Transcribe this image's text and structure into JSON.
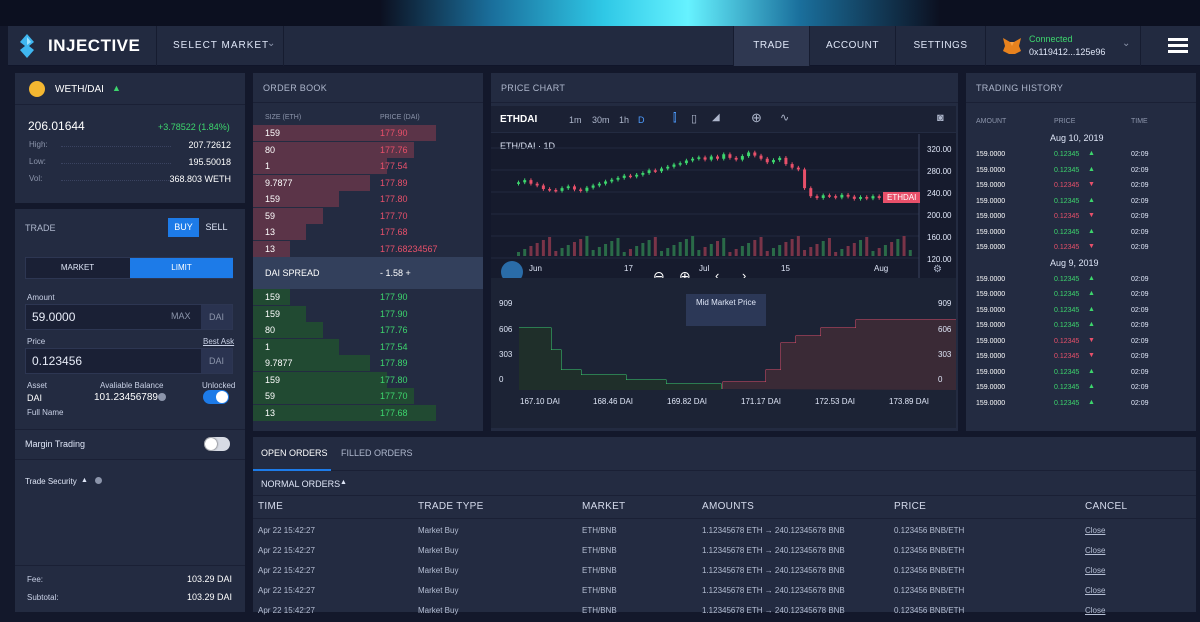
{
  "nav": {
    "brand": "INJECTIVE",
    "select_market": "SELECT MARKET",
    "tabs": [
      "TRADE",
      "ACCOUNT",
      "SETTINGS"
    ],
    "wallet_status": "Connected",
    "wallet_address": "0x119412...125e96"
  },
  "market": {
    "pair": "WETH/DAI",
    "price": "206.01644",
    "change": "+3.78522 (1.84%)",
    "stats": [
      {
        "label": "High:",
        "value": "207.72612"
      },
      {
        "label": "Low:",
        "value": "195.50018"
      },
      {
        "label": "Vol:",
        "value": "368.803 WETH"
      }
    ]
  },
  "trade": {
    "title": "TRADE",
    "buy": "BUY",
    "sell": "SELL",
    "market_tab": "MARKET",
    "limit_tab": "LIMIT",
    "amount_label": "Amount",
    "amount_value": "59.0000",
    "max": "MAX",
    "amount_unit": "DAI",
    "price_label": "Price",
    "best_ask": "Best Ask",
    "price_value": "0.123456",
    "price_unit": "DAI",
    "asset_label": "Asset",
    "asset_value": "DAI",
    "balance_label": "Avaliable Balance",
    "balance_value": "101.23456789",
    "unlocked_label": "Unlocked",
    "full_name": "Full Name",
    "margin": "Margin Trading",
    "security": "Trade Security",
    "fee_label": "Fee:",
    "fee_value": "103.29 DAI",
    "subtotal_label": "Subtotal:",
    "subtotal_value": "103.29 DAI"
  },
  "orderbook": {
    "title": "ORDER BOOK",
    "col_size": "SIZE (ETH)",
    "col_price": "PRICE (DAI)",
    "asks": [
      {
        "size": "159",
        "price": "177.90",
        "depth": 1.0
      },
      {
        "size": "80",
        "price": "177.76",
        "depth": 0.88
      },
      {
        "size": "1",
        "price": "177.54",
        "depth": 0.73
      },
      {
        "size": "9.7877",
        "price": "177.89",
        "depth": 0.64
      },
      {
        "size": "159",
        "price": "177.80",
        "depth": 0.47
      },
      {
        "size": "59",
        "price": "177.70",
        "depth": 0.38
      },
      {
        "size": "13",
        "price": "177.68",
        "depth": 0.29
      },
      {
        "size": "13",
        "price": "177.68234567",
        "depth": 0.2
      }
    ],
    "spread_label": "DAI SPREAD",
    "spread_value": "- 1.58 +",
    "bids": [
      {
        "size": "159",
        "price": "177.90",
        "depth": 0.2
      },
      {
        "size": "159",
        "price": "177.90",
        "depth": 0.29
      },
      {
        "size": "80",
        "price": "177.76",
        "depth": 0.38
      },
      {
        "size": "1",
        "price": "177.54",
        "depth": 0.47
      },
      {
        "size": "9.7877",
        "price": "177.89",
        "depth": 0.64
      },
      {
        "size": "159",
        "price": "177.80",
        "depth": 0.73
      },
      {
        "size": "59",
        "price": "177.70",
        "depth": 0.88
      },
      {
        "size": "13",
        "price": "177.68",
        "depth": 1.0
      }
    ]
  },
  "chart": {
    "title": "PRICE CHART",
    "symbol": "ETHDAI",
    "intervals": [
      "1m",
      "30m",
      "1h",
      "D"
    ],
    "legend": "ETH/DAI · 1D",
    "price_tag": "ETHDAI",
    "y_ticks": [
      "320.00",
      "280.00",
      "240.00",
      "200.00",
      "160.00",
      "120.00"
    ],
    "x_ticks": [
      "Jun",
      "17",
      "Jul",
      "15",
      "Aug"
    ],
    "depth_label": "Mid Market Price",
    "depth_y_ticks": [
      "909",
      "606",
      "303",
      "0"
    ],
    "depth_x_ticks": [
      "167.10 DAI",
      "168.46 DAI",
      "169.82 DAI",
      "171.17 DAI",
      "172.53 DAI",
      "173.89 DAI"
    ]
  },
  "chart_data": {
    "type": "candlestick",
    "y_range": [
      100,
      340
    ],
    "closes": [
      245,
      250,
      242,
      238,
      230,
      228,
      226,
      232,
      236,
      229,
      226,
      233,
      238,
      242,
      247,
      251,
      255,
      260,
      258,
      262,
      266,
      272,
      270,
      276,
      280,
      285,
      288,
      294,
      298,
      301,
      296,
      303,
      298,
      308,
      300,
      296,
      304,
      312,
      305,
      298,
      290,
      295,
      300,
      286,
      278,
      274,
      232,
      214,
      210,
      216,
      214,
      211,
      217,
      213,
      208,
      212,
      209,
      214,
      210,
      211,
      208,
      212,
      210,
      211
    ]
  },
  "history": {
    "title": "TRADING HISTORY",
    "cols": [
      "AMOUNT",
      "PRICE",
      "TIME"
    ],
    "groups": [
      {
        "date": "Aug 10, 2019",
        "rows": [
          {
            "amount": "159.0000",
            "price": "0.12345",
            "dir": "up",
            "time": "02:09"
          },
          {
            "amount": "159.0000",
            "price": "0.12345",
            "dir": "up",
            "time": "02:09"
          },
          {
            "amount": "159.0000",
            "price": "0.12345",
            "dir": "down",
            "time": "02:09"
          },
          {
            "amount": "159.0000",
            "price": "0.12345",
            "dir": "up",
            "time": "02:09"
          },
          {
            "amount": "159.0000",
            "price": "0.12345",
            "dir": "down",
            "time": "02:09"
          },
          {
            "amount": "159.0000",
            "price": "0.12345",
            "dir": "up",
            "time": "02:09"
          },
          {
            "amount": "159.0000",
            "price": "0.12345",
            "dir": "down",
            "time": "02:09"
          }
        ]
      },
      {
        "date": "Aug 9, 2019",
        "rows": [
          {
            "amount": "159.0000",
            "price": "0.12345",
            "dir": "up",
            "time": "02:09"
          },
          {
            "amount": "159.0000",
            "price": "0.12345",
            "dir": "up",
            "time": "02:09"
          },
          {
            "amount": "159.0000",
            "price": "0.12345",
            "dir": "up",
            "time": "02:09"
          },
          {
            "amount": "159.0000",
            "price": "0.12345",
            "dir": "up",
            "time": "02:09"
          },
          {
            "amount": "159.0000",
            "price": "0.12345",
            "dir": "down",
            "time": "02:09"
          },
          {
            "amount": "159.0000",
            "price": "0.12345",
            "dir": "down",
            "time": "02:09"
          },
          {
            "amount": "159.0000",
            "price": "0.12345",
            "dir": "up",
            "time": "02:09"
          },
          {
            "amount": "159.0000",
            "price": "0.12345",
            "dir": "up",
            "time": "02:09"
          },
          {
            "amount": "159.0000",
            "price": "0.12345",
            "dir": "up",
            "time": "02:09"
          }
        ]
      }
    ]
  },
  "orders": {
    "tabs": [
      "OPEN ORDERS",
      "FILLED ORDERS"
    ],
    "filter": "NORMAL ORDERS",
    "headers": [
      "TIME",
      "TRADE TYPE",
      "MARKET",
      "AMOUNTS",
      "PRICE",
      "CANCEL"
    ],
    "rows": [
      [
        "Apr 22 15:42:27",
        "Market Buy",
        "ETH/BNB",
        "1.12345678 ETH → 240.12345678 BNB",
        "0.123456 BNB/ETH",
        "Close"
      ],
      [
        "Apr 22 15:42:27",
        "Market Buy",
        "ETH/BNB",
        "1.12345678 ETH → 240.12345678 BNB",
        "0.123456 BNB/ETH",
        "Close"
      ],
      [
        "Apr 22 15:42:27",
        "Market Buy",
        "ETH/BNB",
        "1.12345678 ETH → 240.12345678 BNB",
        "0.123456 BNB/ETH",
        "Close"
      ],
      [
        "Apr 22 15:42:27",
        "Market Buy",
        "ETH/BNB",
        "1.12345678 ETH → 240.12345678 BNB",
        "0.123456 BNB/ETH",
        "Close"
      ],
      [
        "Apr 22 15:42:27",
        "Market Buy",
        "ETH/BNB",
        "1.12345678 ETH → 240.12345678 BNB",
        "0.123456 BNB/ETH",
        "Close"
      ]
    ]
  },
  "colors": {
    "accent": "#1d7be8",
    "up": "#3dd66d",
    "down": "#e8506a",
    "ask_bg": "#5b3448",
    "bid_bg": "#214a32"
  }
}
